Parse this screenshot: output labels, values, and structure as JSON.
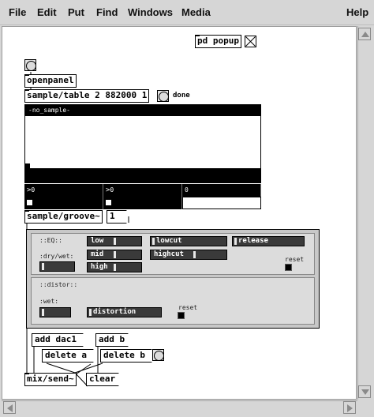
{
  "menu": {
    "items": [
      "File",
      "Edit",
      "Put",
      "Find",
      "Windows",
      "Media"
    ],
    "help": "Help"
  },
  "canvas": {
    "pd_popup": "pd popup",
    "openpanel": "openpanel",
    "sample_table": "sample/table 2 882000 1",
    "done_label": "done",
    "graph_title": "-no_sample-",
    "number_boxes": [
      "0",
      "0",
      "0"
    ],
    "sample_groove": "sample/groove~",
    "groove_msg": "1",
    "eq_title": "::EQ::",
    "drywet_label": ":dry/wet:",
    "sliders": {
      "low": "low",
      "lowcut": "lowcut",
      "release": "release",
      "mid": "mid",
      "highcut": "highcut",
      "high": "high",
      "distortion": "distortion"
    },
    "reset_label": "reset",
    "distor_title": "::distor::",
    "wet_label": ":wet:",
    "add_dac1": "add dac1",
    "add_b": "add b",
    "delete_a": "delete a",
    "delete_b": "delete b",
    "mix_send": "mix/send~",
    "clear": "clear"
  }
}
